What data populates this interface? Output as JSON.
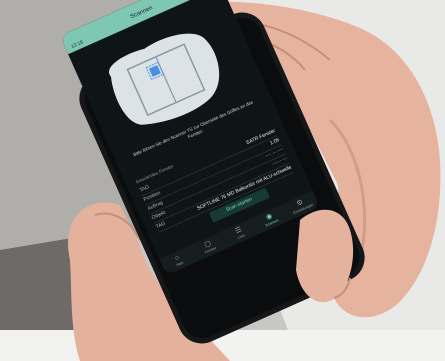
{
  "app": {
    "status_time": "12:18",
    "title": "Scannen"
  },
  "scan": {
    "instruction": "Bitte führen Sie den Scanner TS zur Oberseite des Griffes an das Fenster.",
    "primary_action": "Scan starten"
  },
  "details": {
    "section_label": "Gescanntes Fenster",
    "rows": [
      {
        "key": "TAG",
        "value": "SATR Fenster"
      },
      {
        "key": "Position",
        "value": "1.06"
      },
      {
        "key": "Auftrag",
        "value": "···· ·· ····"
      },
      {
        "key": "Objekt",
        "value": "······ ···"
      },
      {
        "key": "TAG",
        "value": "SOFTLINE 76 MD Balkontür mit ALU-schwelle"
      }
    ]
  },
  "tabs": [
    {
      "label": "Start",
      "icon": "home-icon"
    },
    {
      "label": "Fenster",
      "icon": "window-icon"
    },
    {
      "label": "Liste",
      "icon": "list-icon"
    },
    {
      "label": "Scannen",
      "icon": "nfc-icon",
      "active": true
    },
    {
      "label": "Einstellungen",
      "icon": "gear-icon"
    }
  ],
  "colors": {
    "accent": "#7dc7b3",
    "screen_bg": "#0f1416"
  }
}
